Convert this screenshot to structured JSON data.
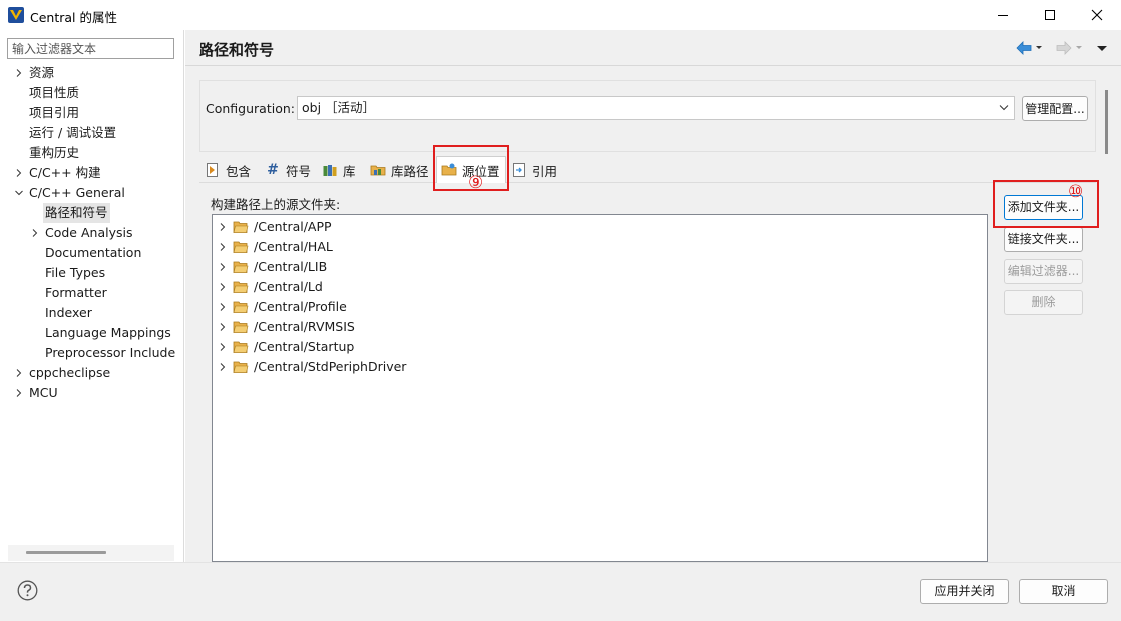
{
  "window": {
    "title": "Central 的属性",
    "colors": {
      "accent": "#0078d4",
      "annotation": "#e01e1e",
      "folder": "#e8b14a"
    }
  },
  "filter": {
    "placeholder": "输入过滤器文本"
  },
  "tree": {
    "items": [
      {
        "label": "资源",
        "expandable": true,
        "expanded": false
      },
      {
        "label": "项目性质"
      },
      {
        "label": "项目引用"
      },
      {
        "label": "运行 / 调试设置"
      },
      {
        "label": "重构历史"
      },
      {
        "label": "C/C++ 构建",
        "expandable": true,
        "expanded": false
      },
      {
        "label": "C/C++ General",
        "expandable": true,
        "expanded": true
      },
      {
        "label": "路径和符号",
        "selected": true
      },
      {
        "label": "Code Analysis",
        "expandable": true,
        "expanded": false
      },
      {
        "label": "Documentation"
      },
      {
        "label": "File Types"
      },
      {
        "label": "Formatter"
      },
      {
        "label": "Indexer"
      },
      {
        "label": "Language Mappings"
      },
      {
        "label": "Preprocessor Include"
      },
      {
        "label": "cppcheclipse",
        "expandable": true,
        "expanded": false
      },
      {
        "label": "MCU",
        "expandable": true,
        "expanded": false
      }
    ]
  },
  "page": {
    "title": "路径和符号",
    "nav": {
      "back": "back-arrow-icon",
      "forward": "forward-arrow-icon",
      "menu": "view-menu-icon"
    }
  },
  "config": {
    "label": "Configuration:",
    "selected": "obj ［活动］",
    "manage_label": "管理配置..."
  },
  "tabs": [
    {
      "label": "包含",
      "icon": "include-icon"
    },
    {
      "label": "符号",
      "icon": "hash-icon"
    },
    {
      "label": "库",
      "icon": "library-icon"
    },
    {
      "label": "库路径",
      "icon": "library-path-icon"
    },
    {
      "label": "源位置",
      "icon": "source-folder-icon",
      "active": true
    },
    {
      "label": "引用",
      "icon": "references-icon"
    }
  ],
  "source": {
    "list_label": "构建路径上的源文件夹:",
    "folders": [
      "/Central/APP",
      "/Central/HAL",
      "/Central/LIB",
      "/Central/Ld",
      "/Central/Profile",
      "/Central/RVMSIS",
      "/Central/Startup",
      "/Central/StdPeriphDriver"
    ],
    "buttons": {
      "add_folder": "添加文件夹...",
      "link_folder": "链接文件夹...",
      "edit_filter": "编辑过滤器...",
      "delete": "删除"
    }
  },
  "annotations": {
    "tab_marker": "⑨",
    "button_marker": "⑩"
  },
  "footer": {
    "apply_close": "应用并关闭",
    "cancel": "取消"
  }
}
